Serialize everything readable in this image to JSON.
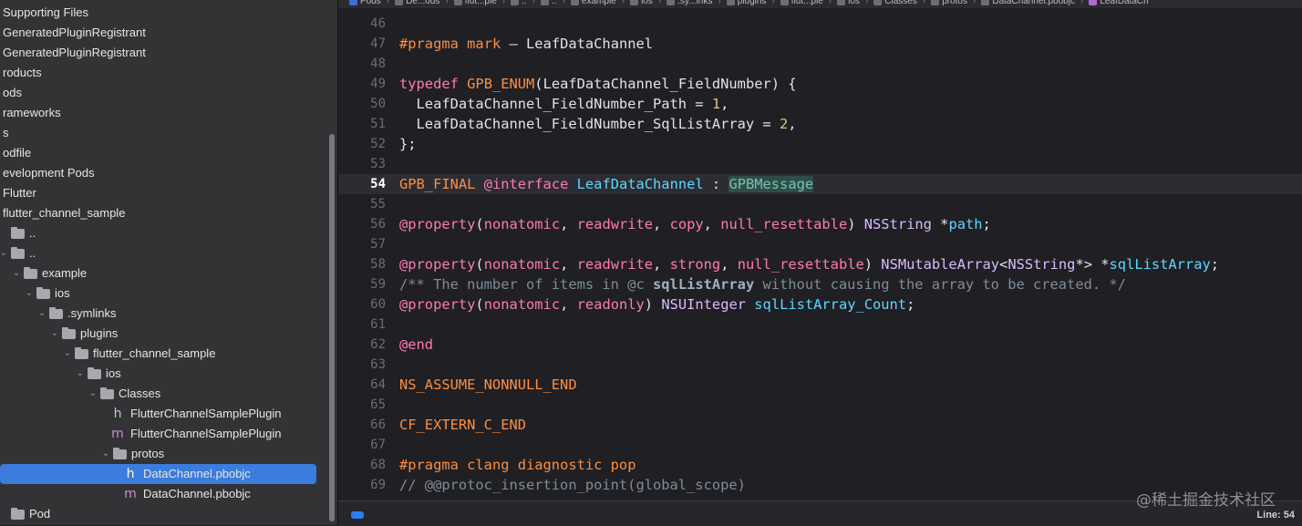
{
  "navigator": {
    "items": [
      {
        "label": "Supporting Files",
        "chev": "",
        "icon": "folder-icon"
      },
      {
        "label": "GeneratedPluginRegistrant",
        "chev": "",
        "icon": "file-icon"
      },
      {
        "label": "GeneratedPluginRegistrant",
        "chev": "",
        "icon": "file-icon"
      },
      {
        "label": "roducts",
        "chev": "",
        "icon": ""
      },
      {
        "label": "ods",
        "chev": "",
        "icon": ""
      },
      {
        "label": "rameworks",
        "chev": "",
        "icon": ""
      },
      {
        "label": "s",
        "chev": "",
        "icon": ""
      },
      {
        "label": "odfile",
        "chev": "",
        "icon": ""
      },
      {
        "label": "evelopment Pods",
        "chev": "",
        "icon": ""
      },
      {
        "label": "Flutter",
        "chev": "",
        "icon": ""
      },
      {
        "label": "flutter_channel_sample",
        "chev": "",
        "icon": ""
      },
      {
        "label": "..",
        "chev": "",
        "icon": "folder-icon"
      },
      {
        "label": "..",
        "chev": "⌄",
        "icon": "folder-icon"
      },
      {
        "label": "example",
        "chev": "⌄",
        "icon": "folder-icon"
      },
      {
        "label": "ios",
        "chev": "⌄",
        "icon": "folder-icon"
      },
      {
        "label": ".symlinks",
        "chev": "⌄",
        "icon": "folder-icon"
      },
      {
        "label": "plugins",
        "chev": "⌄",
        "icon": "folder-icon"
      },
      {
        "label": "flutter_channel_sample",
        "chev": "⌄",
        "icon": "folder-icon"
      },
      {
        "label": "ios",
        "chev": "⌄",
        "icon": "folder-icon"
      },
      {
        "label": "Classes",
        "chev": "⌄",
        "icon": "folder-icon"
      },
      {
        "label": "FlutterChannelSamplePlugin",
        "chev": "",
        "icon": "h",
        "glyph": "h"
      },
      {
        "label": "FlutterChannelSamplePlugin",
        "chev": "",
        "icon": "m",
        "glyph": "m"
      },
      {
        "label": "protos",
        "chev": "⌄",
        "icon": "folder-icon"
      },
      {
        "label": "DataChannel.pbobjc",
        "chev": "",
        "icon": "h",
        "glyph": "h"
      },
      {
        "label": "DataChannel.pbobjc",
        "chev": "",
        "icon": "m",
        "glyph": "m"
      },
      {
        "label": "Pod",
        "chev": "",
        "icon": "folder-icon"
      }
    ]
  },
  "jumpbar": {
    "items": [
      "Pods",
      "De...ods",
      "flut...ple",
      "..",
      "..",
      "example",
      "ios",
      ".sy...inks",
      "plugins",
      "flut...ple",
      "ios",
      "Classes",
      "protos",
      "DataChannel.pbobjc",
      "LeafDataCh"
    ]
  },
  "editor": {
    "current_line": "54",
    "lines": [
      {
        "no": "46"
      },
      {
        "no": "47"
      },
      {
        "no": "48"
      },
      {
        "no": "49"
      },
      {
        "no": "50"
      },
      {
        "no": "51"
      },
      {
        "no": "52"
      },
      {
        "no": "53"
      },
      {
        "no": "54"
      },
      {
        "no": "55"
      },
      {
        "no": "56"
      },
      {
        "no": "57"
      },
      {
        "no": "58"
      },
      {
        "no": "59"
      },
      {
        "no": "60"
      },
      {
        "no": "61"
      },
      {
        "no": "62"
      },
      {
        "no": "63"
      },
      {
        "no": "64"
      },
      {
        "no": "65"
      },
      {
        "no": "66"
      },
      {
        "no": "67"
      },
      {
        "no": "68"
      },
      {
        "no": "69"
      }
    ],
    "code": {
      "l47": {
        "kw": "#pragma",
        "mark": "mark",
        "rest": " – LeafDataChannel"
      },
      "l49": {
        "typedef": "typedef",
        "macro": "GPB_ENUM",
        "rest": "(LeafDataChannel_FieldNumber) {"
      },
      "l50": {
        "name": "  LeafDataChannel_FieldNumber_Path = ",
        "num": "1",
        "end": ","
      },
      "l51": {
        "name": "  LeafDataChannel_FieldNumber_SqlListArray = ",
        "num": "2",
        "end": ","
      },
      "l52": {
        "text": "};"
      },
      "l54": {
        "final": "GPB_FINAL",
        "iface": "@interface",
        "cls": "LeafDataChannel",
        "colon": " : ",
        "super": "GPBMessage"
      },
      "l56": {
        "prop": "@property",
        "open": "(",
        "a1": "nonatomic",
        "c1": ", ",
        "a2": "readwrite",
        "c2": ", ",
        "a3": "copy",
        "c3": ", ",
        "a4": "null_resettable",
        "close": ") ",
        "type": "NSString",
        "star": " *",
        "var": "path",
        "semi": ";"
      },
      "l58": {
        "prop": "@property",
        "open": "(",
        "a1": "nonatomic",
        "c1": ", ",
        "a2": "readwrite",
        "c2": ", ",
        "a3": "strong",
        "c3": ", ",
        "a4": "null_resettable",
        "close": ") ",
        "type": "NSMutableArray",
        "lt": "<",
        "type2": "NSString",
        "gt": "*> *",
        "var": "sqlListArray",
        "semi": ";"
      },
      "l59": {
        "c1": "/** The number of items in ",
        "c2": "@c",
        "c3": " ",
        "c4": "sqlListArray",
        "c5": " without causing the array to be created. */"
      },
      "l60": {
        "prop": "@property",
        "open": "(",
        "a1": "nonatomic",
        "c1": ", ",
        "a2": "readonly",
        "close": ") ",
        "type": "NSUInteger",
        "sp": " ",
        "var": "sqlListArray_Count",
        "semi": ";"
      },
      "l62": {
        "text": "@end"
      },
      "l64": {
        "text": "NS_ASSUME_NONNULL_END"
      },
      "l66": {
        "text": "CF_EXTERN_C_END"
      },
      "l68": {
        "kw": "#pragma",
        "rest": " clang diagnostic pop"
      },
      "l69": {
        "text": "// @@protoc_insertion_point(global_scope)"
      }
    }
  },
  "statusbar": {
    "line_label": "Line: 54"
  },
  "watermark": "@稀土掘金技术社区"
}
